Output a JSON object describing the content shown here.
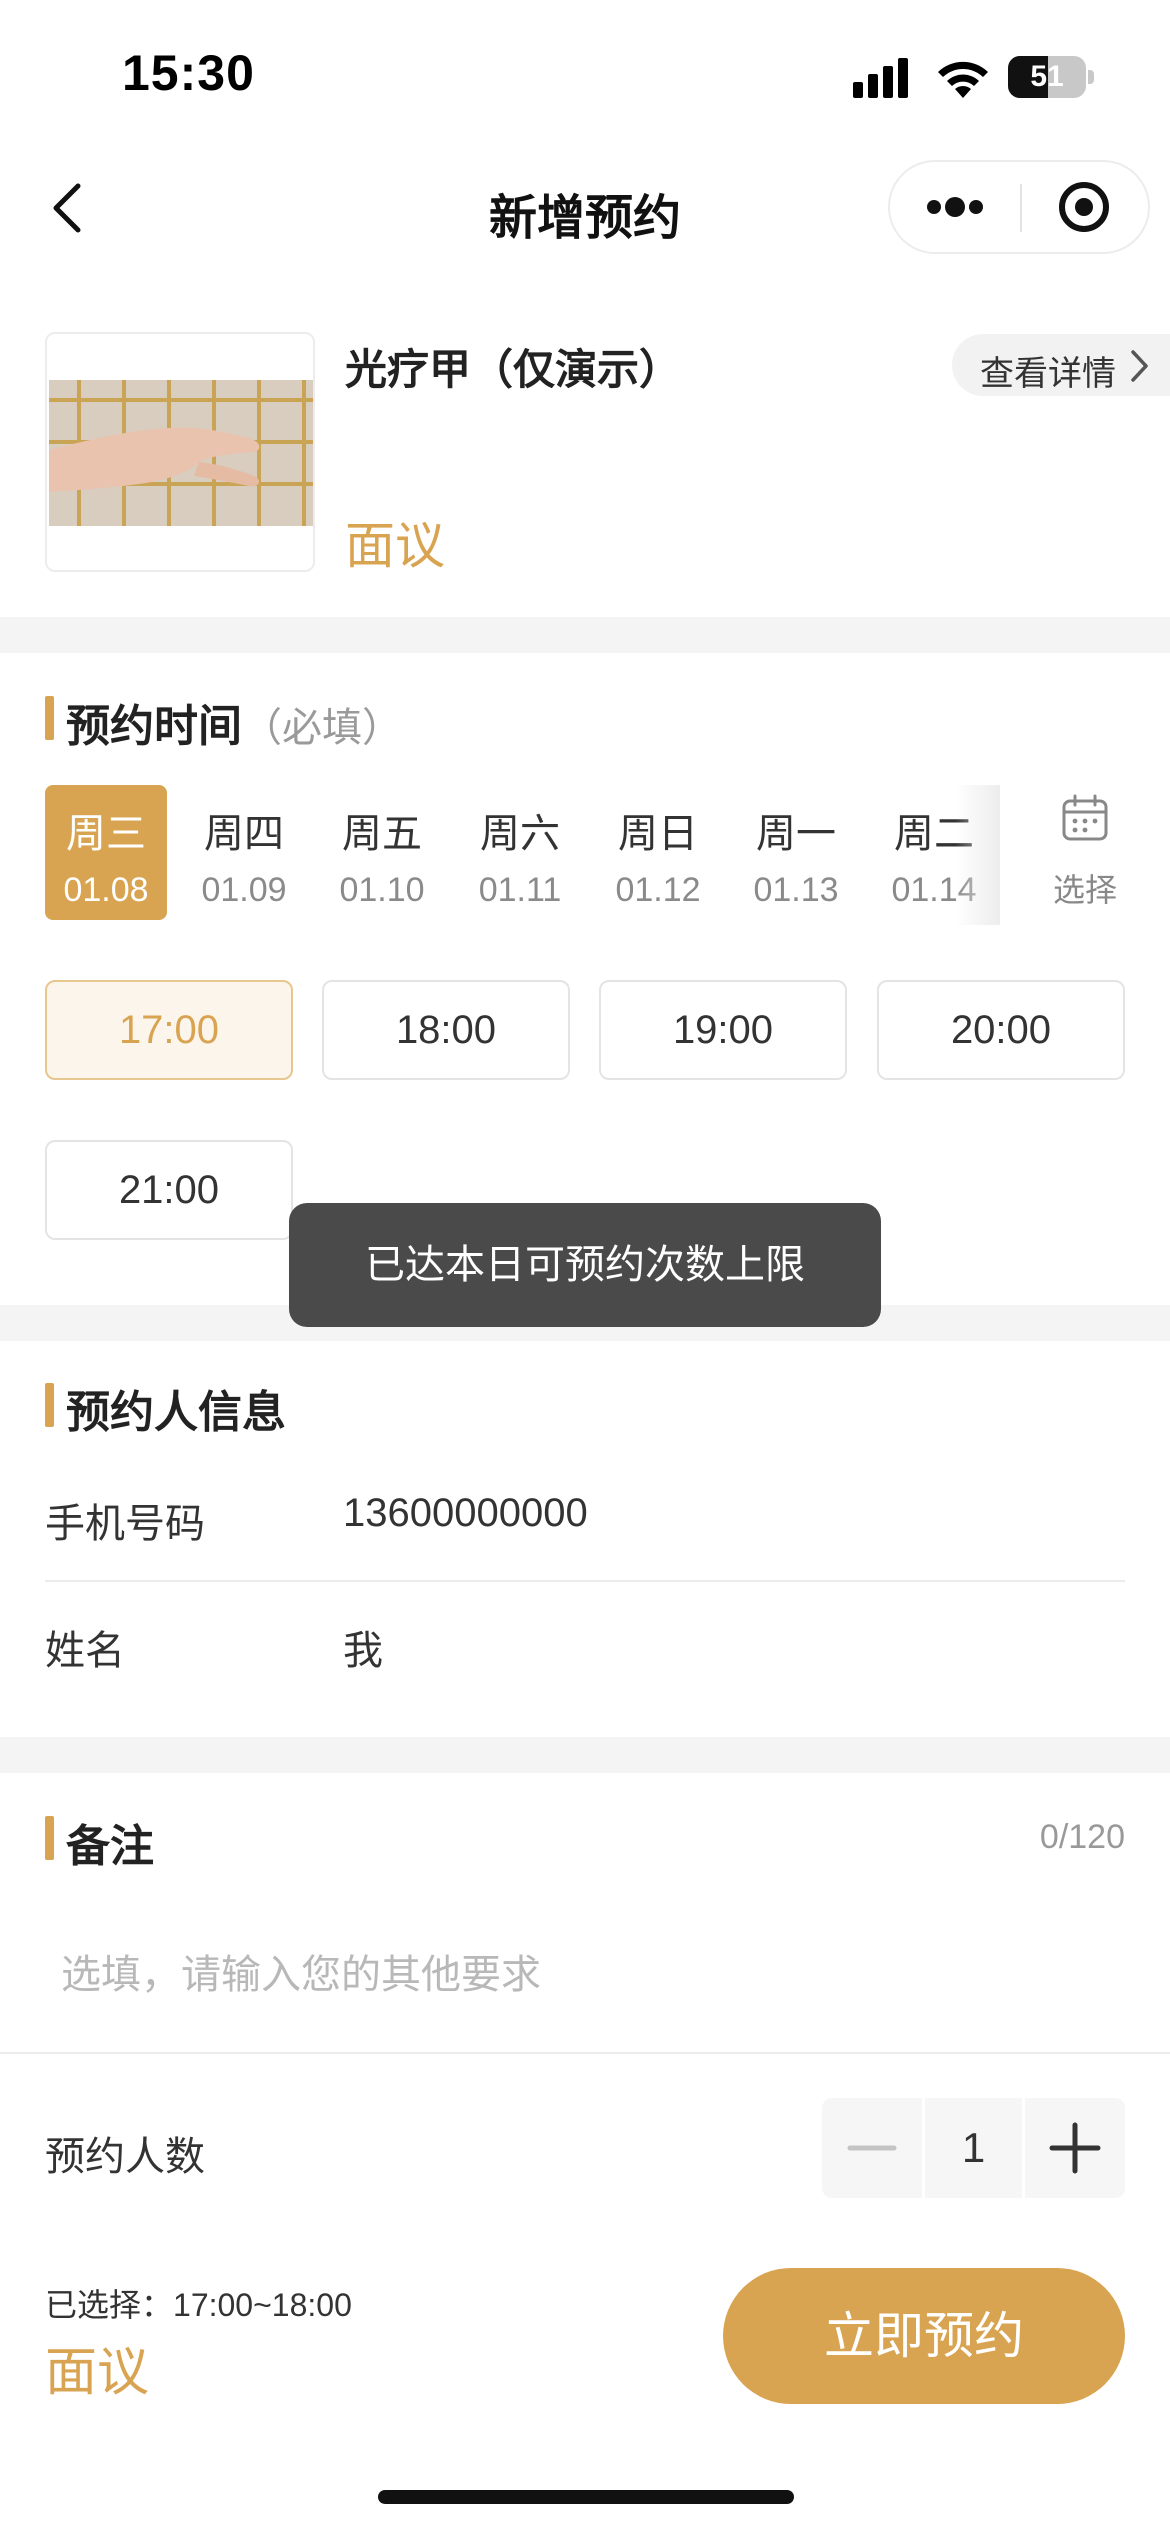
{
  "status_bar": {
    "time": "15:30",
    "battery": "51",
    "battery_level": 0.51
  },
  "nav": {
    "title": "新增预约"
  },
  "product": {
    "name": "光疗甲（仅演示）",
    "price": "面议",
    "detail_label": "查看详情"
  },
  "appointment_time": {
    "title": "预约时间",
    "hint": "（必填）",
    "dates": [
      {
        "week": "周三",
        "day": "01.08",
        "selected": true
      },
      {
        "week": "周四",
        "day": "01.09",
        "selected": false
      },
      {
        "week": "周五",
        "day": "01.10",
        "selected": false
      },
      {
        "week": "周六",
        "day": "01.11",
        "selected": false
      },
      {
        "week": "周日",
        "day": "01.12",
        "selected": false
      },
      {
        "week": "周一",
        "day": "01.13",
        "selected": false
      },
      {
        "week": "周二",
        "day": "01.14",
        "selected": false
      }
    ],
    "picker_label": "选择",
    "slots": [
      {
        "time": "17:00",
        "selected": true
      },
      {
        "time": "18:00",
        "selected": false
      },
      {
        "time": "19:00",
        "selected": false
      },
      {
        "time": "20:00",
        "selected": false
      },
      {
        "time": "21:00",
        "selected": false
      }
    ]
  },
  "toast": {
    "message": "已达本日可预约次数上限"
  },
  "booker_info": {
    "title": "预约人信息",
    "phone_label": "手机号码",
    "phone_value": "13600000000",
    "name_label": "姓名",
    "name_value": "我"
  },
  "remark": {
    "title": "备注",
    "count": "0/120",
    "placeholder": "选填，请输入您的其他要求",
    "value": ""
  },
  "party_size": {
    "label": "预约人数",
    "value": "1"
  },
  "footer": {
    "selected_label": "已选择：",
    "selected_range": "17:00~18:00",
    "price": "面议",
    "book_button": "立即预约"
  },
  "colors": {
    "accent": "#d9a451",
    "accent_light": "#fbf5ec",
    "toast_bg": "#4a4a4a"
  }
}
